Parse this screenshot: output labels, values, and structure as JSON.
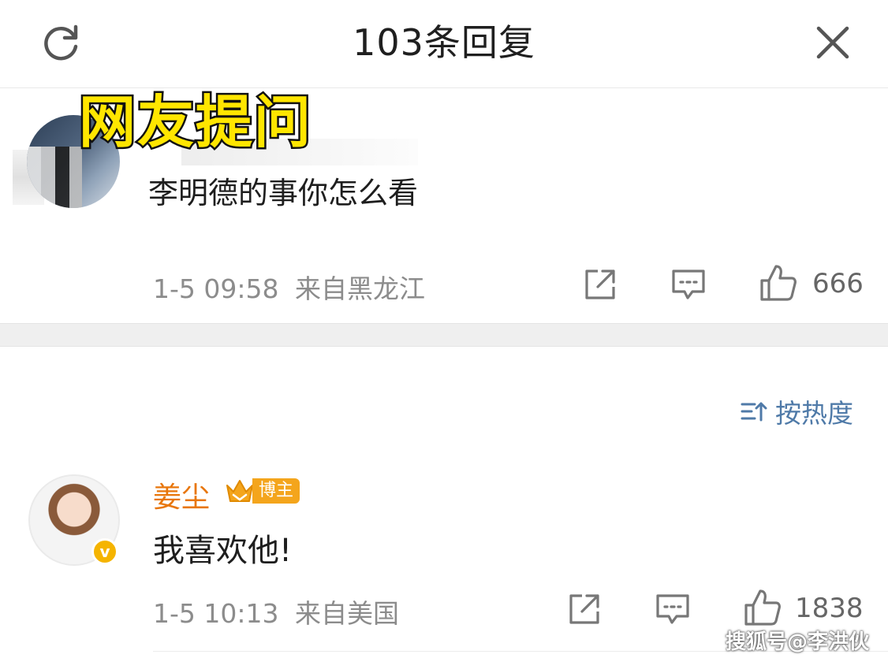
{
  "header": {
    "title": "103条回复",
    "refresh_icon": "refresh-icon",
    "close_icon": "close-icon"
  },
  "overlay": {
    "label": "网友提问",
    "color": "#ffe600"
  },
  "comments": [
    {
      "text": "李明德的事你怎么看",
      "timestamp": "1-5 09:58",
      "location": "来自黑龙江",
      "likes": "666"
    },
    {
      "username": "姜尘",
      "badge": "博主",
      "verified_label": "v",
      "text": "我喜欢他!",
      "timestamp": "1-5 10:13",
      "location": "来自美国",
      "likes": "1838"
    }
  ],
  "sort": {
    "label": "按热度",
    "icon": "sort-icon"
  },
  "watermark": "搜狐号@李洪伙",
  "colors": {
    "username": "#e8760b",
    "sort_link": "#4f7aa8",
    "badge": "#f4a51c",
    "verified": "#f5b400"
  }
}
